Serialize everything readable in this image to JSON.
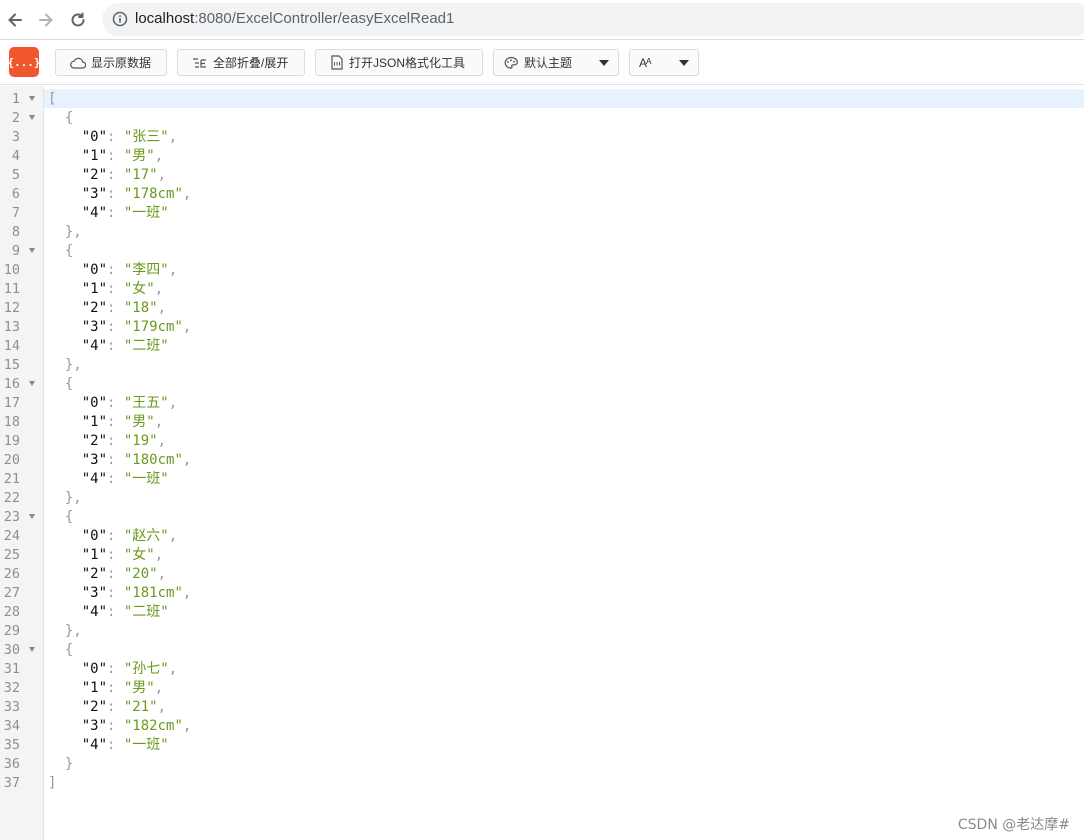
{
  "browser": {
    "url_host": "localhost",
    "url_path": ":8080/ExcelController/easyExcelRead1"
  },
  "toolbar": {
    "logo_text": "{...}",
    "show_raw_label": "显示原数据",
    "fold_all_label": "全部折叠/展开",
    "open_json_tool_label": "打开JSON格式化工具",
    "theme_select_label": "默认主题",
    "font_select_label": "Aᴬ"
  },
  "json_lines": [
    {
      "n": "1",
      "fold": true,
      "indent": "",
      "t": "open",
      "text": "["
    },
    {
      "n": "2",
      "fold": true,
      "indent": "  ",
      "t": "open",
      "text": "{"
    },
    {
      "n": "3",
      "indent": "    ",
      "t": "kv",
      "k": "\"0\"",
      "v": "\"张三\"",
      "c": ","
    },
    {
      "n": "4",
      "indent": "    ",
      "t": "kv",
      "k": "\"1\"",
      "v": "\"男\"",
      "c": ","
    },
    {
      "n": "5",
      "indent": "    ",
      "t": "kv",
      "k": "\"2\"",
      "v": "\"17\"",
      "c": ","
    },
    {
      "n": "6",
      "indent": "    ",
      "t": "kv",
      "k": "\"3\"",
      "v": "\"178cm\"",
      "c": ","
    },
    {
      "n": "7",
      "indent": "    ",
      "t": "kv",
      "k": "\"4\"",
      "v": "\"一班\"",
      "c": ""
    },
    {
      "n": "8",
      "indent": "  ",
      "t": "close",
      "text": "},"
    },
    {
      "n": "9",
      "fold": true,
      "indent": "  ",
      "t": "open",
      "text": "{"
    },
    {
      "n": "10",
      "indent": "    ",
      "t": "kv",
      "k": "\"0\"",
      "v": "\"李四\"",
      "c": ","
    },
    {
      "n": "11",
      "indent": "    ",
      "t": "kv",
      "k": "\"1\"",
      "v": "\"女\"",
      "c": ","
    },
    {
      "n": "12",
      "indent": "    ",
      "t": "kv",
      "k": "\"2\"",
      "v": "\"18\"",
      "c": ","
    },
    {
      "n": "13",
      "indent": "    ",
      "t": "kv",
      "k": "\"3\"",
      "v": "\"179cm\"",
      "c": ","
    },
    {
      "n": "14",
      "indent": "    ",
      "t": "kv",
      "k": "\"4\"",
      "v": "\"二班\"",
      "c": ""
    },
    {
      "n": "15",
      "indent": "  ",
      "t": "close",
      "text": "},"
    },
    {
      "n": "16",
      "fold": true,
      "indent": "  ",
      "t": "open",
      "text": "{"
    },
    {
      "n": "17",
      "indent": "    ",
      "t": "kv",
      "k": "\"0\"",
      "v": "\"王五\"",
      "c": ","
    },
    {
      "n": "18",
      "indent": "    ",
      "t": "kv",
      "k": "\"1\"",
      "v": "\"男\"",
      "c": ","
    },
    {
      "n": "19",
      "indent": "    ",
      "t": "kv",
      "k": "\"2\"",
      "v": "\"19\"",
      "c": ","
    },
    {
      "n": "20",
      "indent": "    ",
      "t": "kv",
      "k": "\"3\"",
      "v": "\"180cm\"",
      "c": ","
    },
    {
      "n": "21",
      "indent": "    ",
      "t": "kv",
      "k": "\"4\"",
      "v": "\"一班\"",
      "c": ""
    },
    {
      "n": "22",
      "indent": "  ",
      "t": "close",
      "text": "},"
    },
    {
      "n": "23",
      "fold": true,
      "indent": "  ",
      "t": "open",
      "text": "{"
    },
    {
      "n": "24",
      "indent": "    ",
      "t": "kv",
      "k": "\"0\"",
      "v": "\"赵六\"",
      "c": ","
    },
    {
      "n": "25",
      "indent": "    ",
      "t": "kv",
      "k": "\"1\"",
      "v": "\"女\"",
      "c": ","
    },
    {
      "n": "26",
      "indent": "    ",
      "t": "kv",
      "k": "\"2\"",
      "v": "\"20\"",
      "c": ","
    },
    {
      "n": "27",
      "indent": "    ",
      "t": "kv",
      "k": "\"3\"",
      "v": "\"181cm\"",
      "c": ","
    },
    {
      "n": "28",
      "indent": "    ",
      "t": "kv",
      "k": "\"4\"",
      "v": "\"二班\"",
      "c": ""
    },
    {
      "n": "29",
      "indent": "  ",
      "t": "close",
      "text": "},"
    },
    {
      "n": "30",
      "fold": true,
      "indent": "  ",
      "t": "open",
      "text": "{"
    },
    {
      "n": "31",
      "indent": "    ",
      "t": "kv",
      "k": "\"0\"",
      "v": "\"孙七\"",
      "c": ","
    },
    {
      "n": "32",
      "indent": "    ",
      "t": "kv",
      "k": "\"1\"",
      "v": "\"男\"",
      "c": ","
    },
    {
      "n": "33",
      "indent": "    ",
      "t": "kv",
      "k": "\"2\"",
      "v": "\"21\"",
      "c": ","
    },
    {
      "n": "34",
      "indent": "    ",
      "t": "kv",
      "k": "\"3\"",
      "v": "\"182cm\"",
      "c": ","
    },
    {
      "n": "35",
      "indent": "    ",
      "t": "kv",
      "k": "\"4\"",
      "v": "\"一班\"",
      "c": ""
    },
    {
      "n": "36",
      "indent": "  ",
      "t": "close",
      "text": "}"
    },
    {
      "n": "37",
      "indent": "",
      "t": "close",
      "text": "]"
    }
  ],
  "watermark": "CSDN @老达摩#",
  "colors": {
    "logo": "#f0572d",
    "json_key": "#111111",
    "json_string": "#6a9a1d",
    "json_punctuation": "#999999",
    "active_line": "#e8f2ff"
  }
}
